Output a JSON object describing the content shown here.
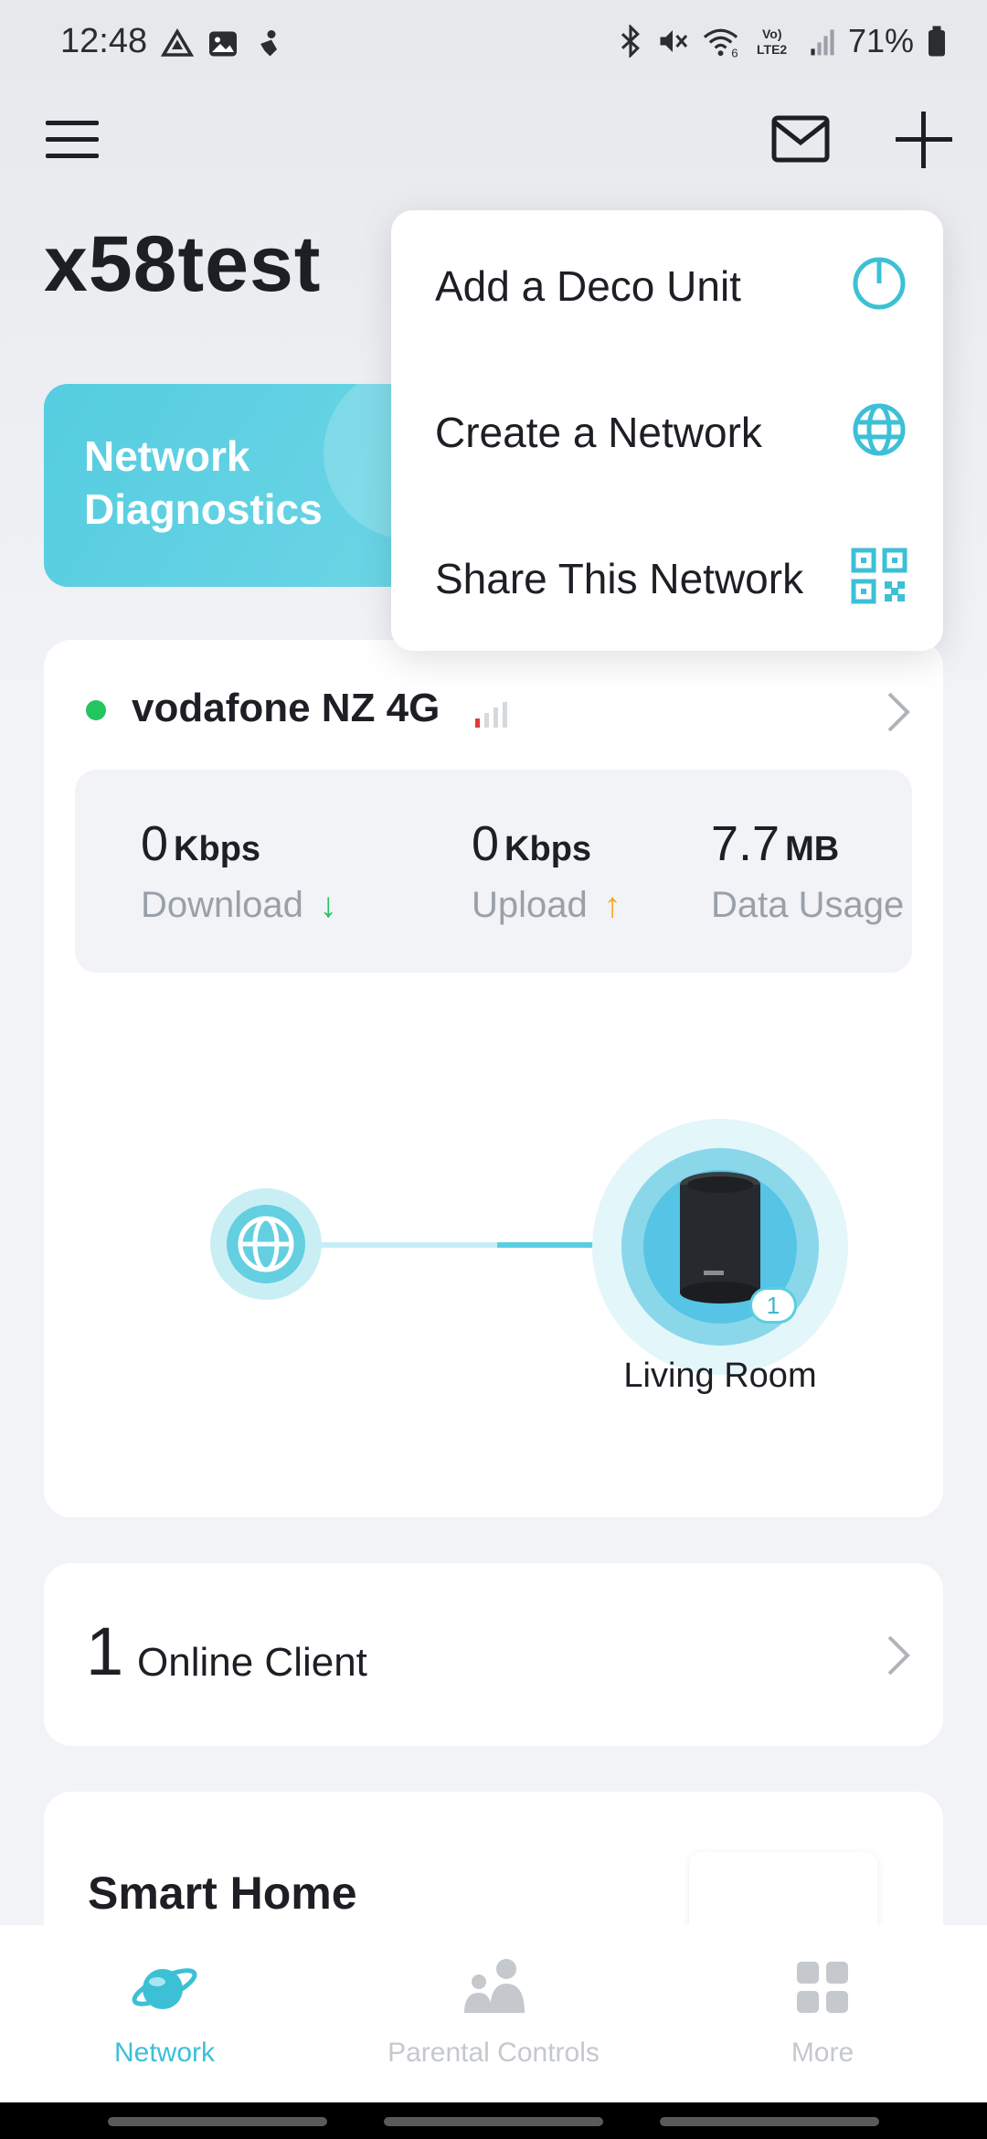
{
  "status_bar": {
    "time": "12:48",
    "battery": "71%",
    "left_icons": [
      "drive-icon",
      "image-icon",
      "notification-icon"
    ],
    "right_icons": [
      "bluetooth-icon",
      "mute-icon",
      "wifi-6-icon",
      "volte-lte2-icon",
      "cellular-signal-icon",
      "battery-icon"
    ]
  },
  "header": {
    "network_name": "x58test",
    "icons": [
      "menu-icon",
      "mail-icon",
      "plus-icon"
    ]
  },
  "diagnostics": {
    "label": "Network Diagnostics"
  },
  "dropdown": {
    "items": [
      {
        "label": "Add a Deco Unit",
        "icon": "deco-unit-icon"
      },
      {
        "label": "Create a Network",
        "icon": "globe-icon"
      },
      {
        "label": "Share This Network",
        "icon": "qr-code-icon"
      }
    ]
  },
  "connection": {
    "isp": "vodafone NZ 4G",
    "status_color": "#22c55e",
    "download": {
      "value": "0",
      "unit": "Kbps",
      "label": "Download"
    },
    "upload": {
      "value": "0",
      "unit": "Kbps",
      "label": "Upload"
    },
    "usage": {
      "value": "7.7",
      "unit": "MB",
      "label": "Data Usage"
    },
    "device_label": "Living Room",
    "device_client_count": "1"
  },
  "clients": {
    "count": "1",
    "label": "Online Client"
  },
  "smart_home": {
    "title": "Smart Home"
  },
  "bottom_nav": [
    {
      "label": "Network",
      "icon": "planet-icon",
      "active": true
    },
    {
      "label": "Parental Controls",
      "icon": "family-icon",
      "active": false
    },
    {
      "label": "More",
      "icon": "grid-icon",
      "active": false
    }
  ],
  "colors": {
    "accent": "#3cc0d6",
    "upload_arrow": "#f5a623",
    "download_arrow": "#22c55e"
  }
}
